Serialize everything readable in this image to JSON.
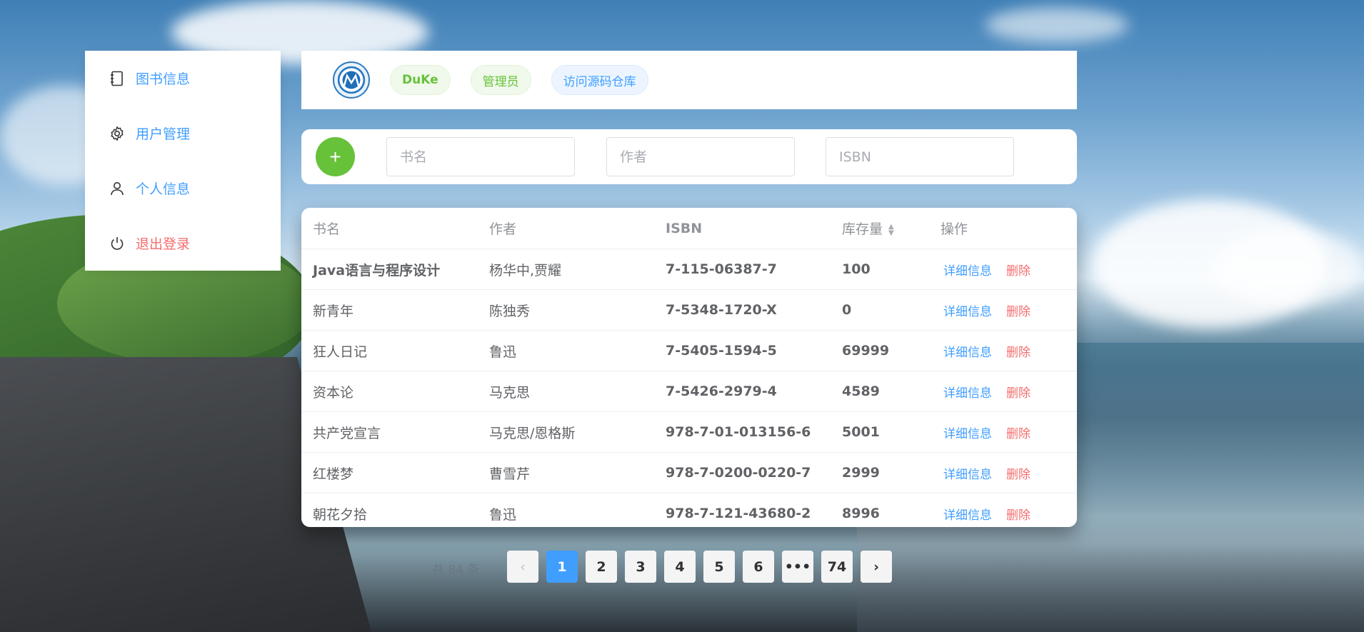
{
  "sidebar": {
    "items": [
      {
        "label": "图书信息",
        "icon": "notebook-icon"
      },
      {
        "label": "用户管理",
        "icon": "gear-icon"
      },
      {
        "label": "个人信息",
        "icon": "user-icon"
      },
      {
        "label": "退出登录",
        "icon": "power-icon"
      }
    ]
  },
  "header": {
    "tag_user": "DuKe",
    "tag_role": "管理员",
    "tag_repo": "访问源码仓库"
  },
  "search": {
    "name_placeholder": "书名",
    "author_placeholder": "作者",
    "isbn_placeholder": "ISBN",
    "add_label": "+"
  },
  "table": {
    "headers": [
      "书名",
      "作者",
      "ISBN",
      "库存量",
      "操作"
    ],
    "detail_label": "详细信息",
    "delete_label": "删除",
    "rows": [
      {
        "name": "Java语言与程序设计",
        "author": "杨华中,贾耀",
        "isbn": "7-115-06387-7",
        "stock": "100"
      },
      {
        "name": "新青年",
        "author": "陈独秀",
        "isbn": "7-5348-1720-X",
        "stock": "0"
      },
      {
        "name": "狂人日记",
        "author": "鲁迅",
        "isbn": "7-5405-1594-5",
        "stock": "69999"
      },
      {
        "name": "资本论",
        "author": "马克思",
        "isbn": "7-5426-2979-4",
        "stock": "4589"
      },
      {
        "name": "共产党宣言",
        "author": "马克思/恩格斯",
        "isbn": "978-7-01-013156-6",
        "stock": "5001"
      },
      {
        "name": "红楼梦",
        "author": "曹雪芹",
        "isbn": "978-7-0200-0220-7",
        "stock": "2999"
      },
      {
        "name": "朝花夕拾",
        "author": "鲁迅",
        "isbn": "978-7-121-43680-2",
        "stock": "8996"
      }
    ]
  },
  "pagination": {
    "total": "共 84 条",
    "pages": [
      "1",
      "2",
      "3",
      "4",
      "5",
      "6",
      "•••",
      "74"
    ],
    "current": "1",
    "prev": "‹",
    "next": "›"
  },
  "colors": {
    "primary": "#409eff",
    "danger": "#f56c6c",
    "success": "#67c23a"
  }
}
